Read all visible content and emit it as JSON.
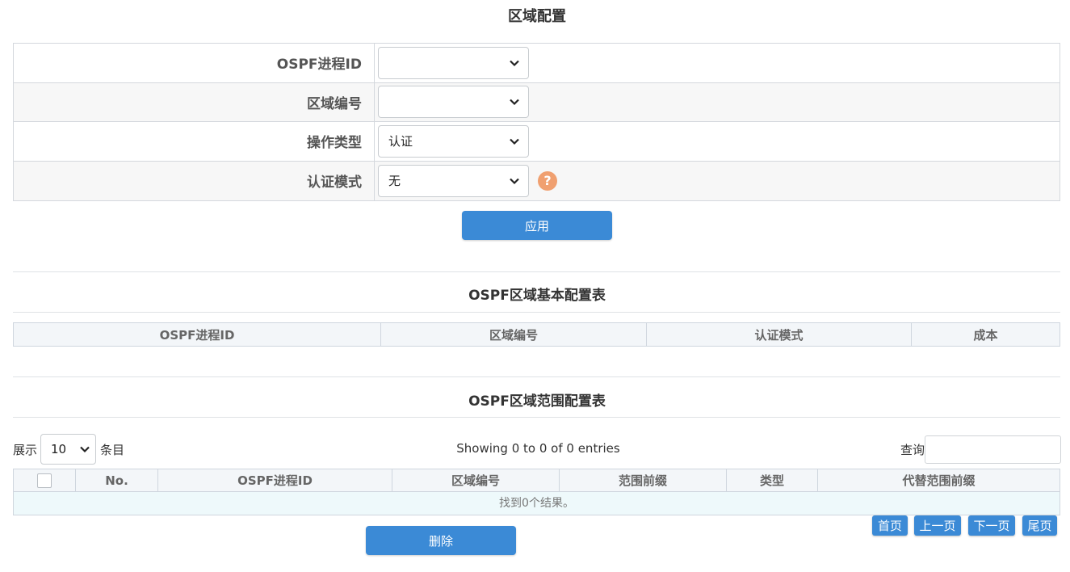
{
  "area_config": {
    "title": "区域配置",
    "fields": [
      {
        "label": "OSPF进程ID",
        "value": ""
      },
      {
        "label": "区域编号",
        "value": ""
      },
      {
        "label": "操作类型",
        "value": "认证"
      },
      {
        "label": "认证模式",
        "value": "无"
      }
    ],
    "help_icon": "?",
    "apply_label": "应用"
  },
  "basic_table": {
    "title": "OSPF区域基本配置表",
    "columns": [
      "OSPF进程ID",
      "区域编号",
      "认证模式",
      "成本"
    ]
  },
  "range_table": {
    "title": "OSPF区域范围配置表",
    "show_label": "展示",
    "page_size": "10",
    "entries_label": "条目",
    "info": "Showing 0 to 0 of 0 entries",
    "search_label": "查询",
    "search_value": "",
    "columns": [
      "No.",
      "OSPF进程ID",
      "区域编号",
      "范围前缀",
      "类型",
      "代替范围前缀"
    ],
    "empty_text": "找到0个结果。",
    "delete_label": "删除",
    "pagination": {
      "first": "首页",
      "prev": "上一页",
      "next": "下一页",
      "last": "尾页"
    }
  },
  "colors": {
    "accent": "#3b8ad6",
    "help": "#f0a070",
    "header_bg": "#f3f6f9",
    "empty_row_bg": "#eef9fb"
  }
}
